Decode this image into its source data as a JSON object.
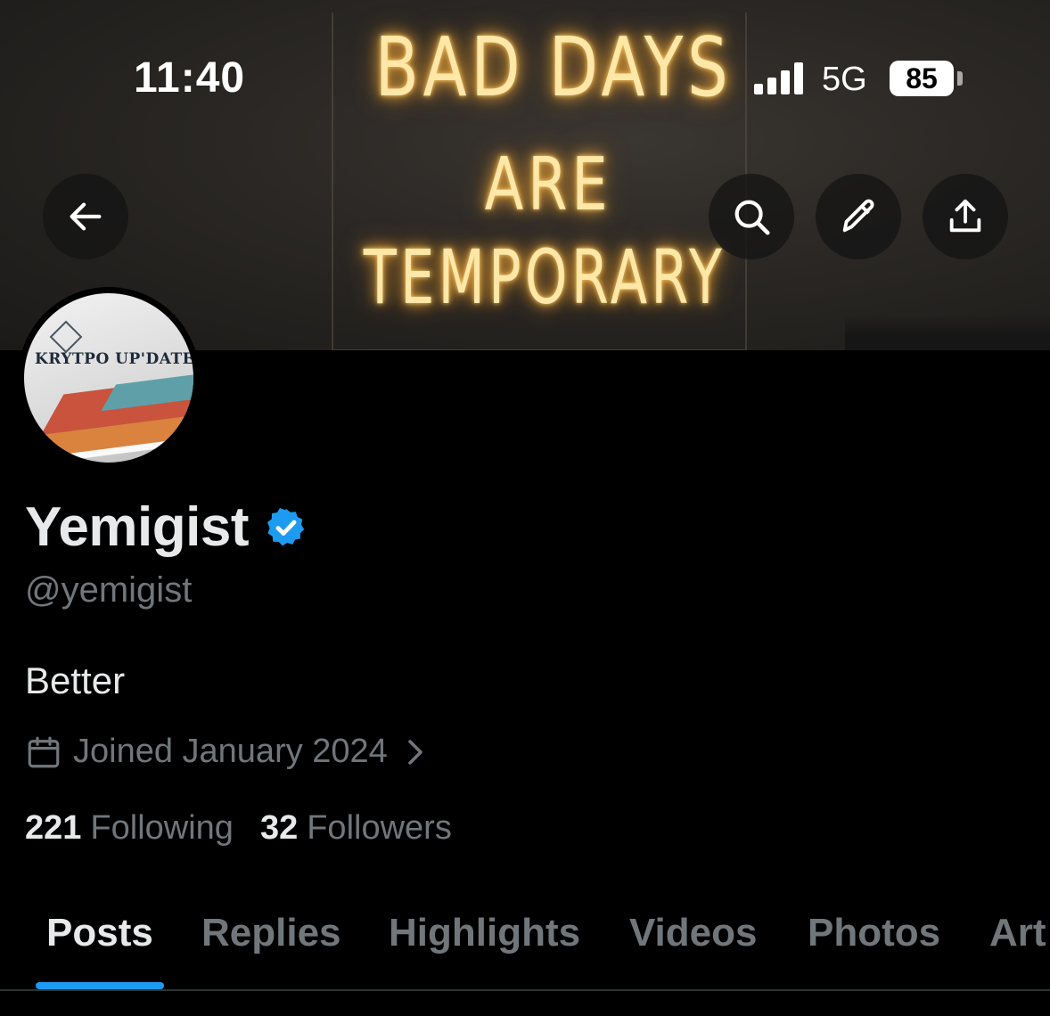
{
  "status_bar": {
    "time": "11:40",
    "network": "5G",
    "battery": "85"
  },
  "banner": {
    "neon_lines": [
      "BAD DAYS",
      "ARE",
      "TEMPORARY"
    ]
  },
  "header_buttons": {
    "back_icon": "arrow-left-icon",
    "search_icon": "search-icon",
    "edit_icon": "pencil-icon",
    "share_icon": "share-upload-icon"
  },
  "avatar": {
    "logo_text": "KRYTPO UP'DATE"
  },
  "profile": {
    "name": "Yemigist",
    "handle": "@yemigist",
    "bio": "Better",
    "joined": "Joined January 2024",
    "following_count": "221",
    "following_label": "Following",
    "followers_count": "32",
    "followers_label": "Followers"
  },
  "tabs": [
    {
      "label": "Posts",
      "active": true
    },
    {
      "label": "Replies",
      "active": false
    },
    {
      "label": "Highlights",
      "active": false
    },
    {
      "label": "Videos",
      "active": false
    },
    {
      "label": "Photos",
      "active": false
    },
    {
      "label": "Art",
      "active": false
    }
  ],
  "colors": {
    "accent": "#1d9bf0",
    "background": "#000000",
    "primary_text": "#e7e9ea",
    "secondary_text": "#71767b"
  }
}
